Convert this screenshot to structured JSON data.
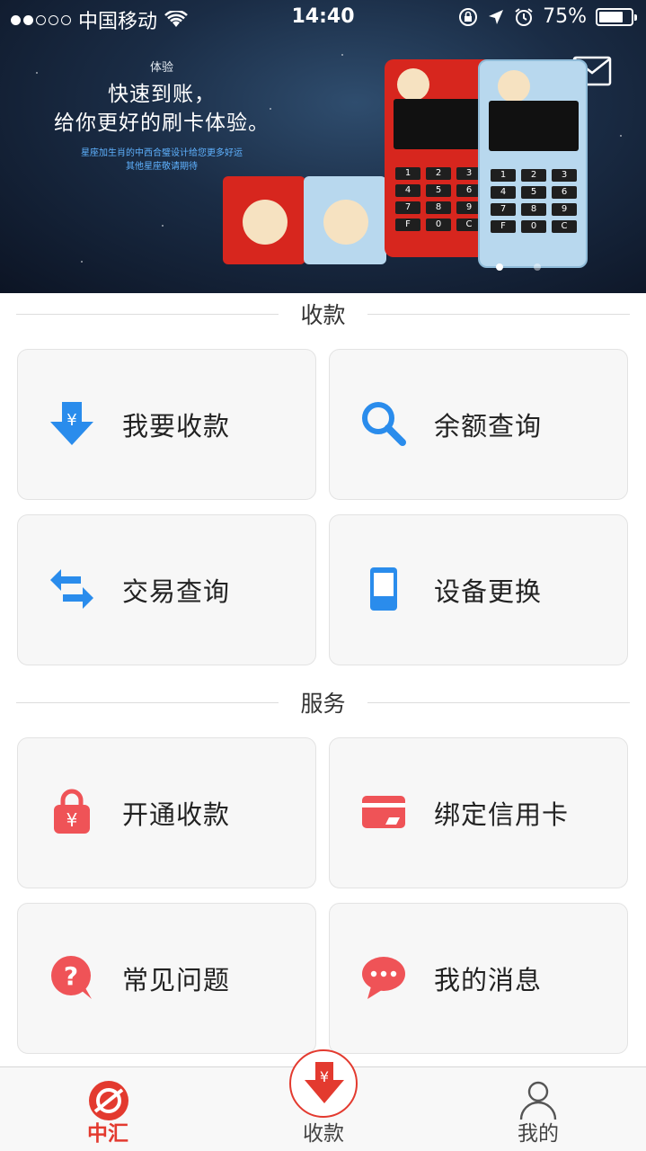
{
  "status_bar": {
    "carrier": "中国移动",
    "time": "14:40",
    "battery_percent": "75%",
    "battery_level": 0.75,
    "signal_bars": 2
  },
  "banner": {
    "top_label": "体验",
    "headline_line1": "快速到账，",
    "headline_line2": "给你更好的刷卡体验。",
    "small_line1": "星座加生肖的中西合璧设计给您更多好运",
    "small_line2": "其他星座敬请期待",
    "device_keys": [
      "1",
      "2",
      "3",
      "4",
      "5",
      "6",
      "7",
      "8",
      "9",
      "F",
      "0",
      "C"
    ],
    "page_count": 2,
    "current_page": 1
  },
  "sections": {
    "collect_title": "收款",
    "service_title": "服务"
  },
  "collect_tiles": [
    {
      "label": "我要收款",
      "icon": "download-yen-icon"
    },
    {
      "label": "余额查询",
      "icon": "search-icon"
    },
    {
      "label": "交易查询",
      "icon": "swap-arrows-icon"
    },
    {
      "label": "设备更换",
      "icon": "device-icon"
    }
  ],
  "service_tiles": [
    {
      "label": "开通收款",
      "icon": "lock-yen-icon"
    },
    {
      "label": "绑定信用卡",
      "icon": "credit-card-icon"
    },
    {
      "label": "常见问题",
      "icon": "question-bubble-icon"
    },
    {
      "label": "我的消息",
      "icon": "chat-bubble-icon"
    }
  ],
  "tabbar": {
    "tabs": [
      {
        "label": "中汇",
        "icon": "zhonghui-logo-icon",
        "active": true
      },
      {
        "label": "收款",
        "icon": "collect-yen-icon",
        "active": false
      },
      {
        "label": "我的",
        "icon": "person-icon",
        "active": false
      }
    ]
  },
  "colors": {
    "accent_red": "#e33a2f",
    "icon_blue": "#2a8cec",
    "icon_red": "#ef5357",
    "tile_bg": "#f7f7f7"
  }
}
